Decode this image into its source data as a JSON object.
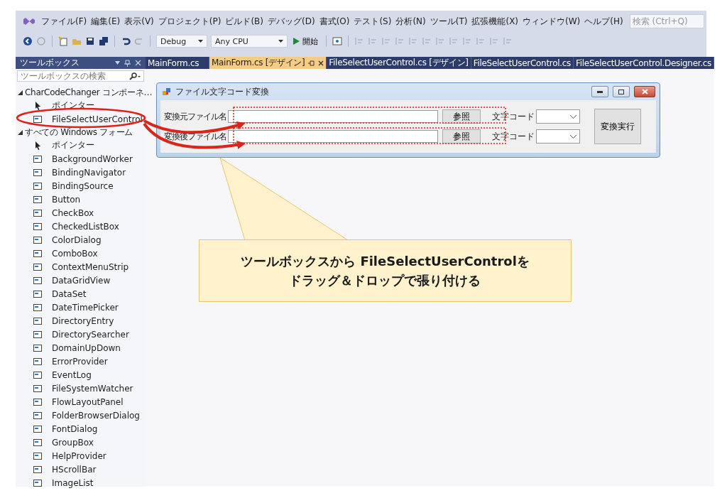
{
  "menu_bar": {
    "items": [
      "ファイル(F)",
      "編集(E)",
      "表示(V)",
      "プロジェクト(P)",
      "ビルド(B)",
      "デバッグ(D)",
      "書式(O)",
      "テスト(S)",
      "分析(N)",
      "ツール(T)",
      "拡張機能(X)",
      "ウィンドウ(W)",
      "ヘルプ(H)"
    ],
    "search": {
      "placeholder": "検索 (Ctrl+Q)"
    }
  },
  "toolbar": {
    "configuration": "Debug",
    "platform": "Any CPU",
    "start_button": "開始"
  },
  "toolbox": {
    "title": "ツールボックス",
    "search": {
      "placeholder": "ツールボックスの検索"
    },
    "groups": [
      {
        "label": "CharCodeChanger コンポーネ…",
        "expanded": true,
        "children": [
          {
            "label": "ポインター",
            "kind": "pointer"
          },
          {
            "label": "FileSelectUserControl",
            "kind": "control"
          }
        ]
      },
      {
        "label": "すべての Windows フォーム",
        "expanded": true,
        "children": [
          {
            "label": "ポインター",
            "kind": "pointer"
          },
          {
            "label": "BackgroundWorker",
            "kind": "control"
          },
          {
            "label": "BindingNavigator",
            "kind": "control"
          },
          {
            "label": "BindingSource",
            "kind": "control"
          },
          {
            "label": "Button",
            "kind": "control"
          },
          {
            "label": "CheckBox",
            "kind": "control"
          },
          {
            "label": "CheckedListBox",
            "kind": "control"
          },
          {
            "label": "ColorDialog",
            "kind": "control"
          },
          {
            "label": "ComboBox",
            "kind": "control"
          },
          {
            "label": "ContextMenuStrip",
            "kind": "control"
          },
          {
            "label": "DataGridView",
            "kind": "control"
          },
          {
            "label": "DataSet",
            "kind": "control"
          },
          {
            "label": "DateTimePicker",
            "kind": "control"
          },
          {
            "label": "DirectoryEntry",
            "kind": "control"
          },
          {
            "label": "DirectorySearcher",
            "kind": "control"
          },
          {
            "label": "DomainUpDown",
            "kind": "control"
          },
          {
            "label": "ErrorProvider",
            "kind": "control"
          },
          {
            "label": "EventLog",
            "kind": "control"
          },
          {
            "label": "FileSystemWatcher",
            "kind": "control"
          },
          {
            "label": "FlowLayoutPanel",
            "kind": "control"
          },
          {
            "label": "FolderBrowserDialog",
            "kind": "control"
          },
          {
            "label": "FontDialog",
            "kind": "control"
          },
          {
            "label": "GroupBox",
            "kind": "control"
          },
          {
            "label": "HelpProvider",
            "kind": "control"
          },
          {
            "label": "HScrollBar",
            "kind": "control"
          },
          {
            "label": "ImageList",
            "kind": "control"
          }
        ]
      }
    ]
  },
  "tabs": [
    {
      "label": "MainForm.cs",
      "selected": false
    },
    {
      "label": "MainForm.cs [デザイン]",
      "selected": true
    },
    {
      "label": "FileSelectUserControl.cs [デザイン]",
      "selected": false
    },
    {
      "label": "FileSelectUserControl.cs",
      "selected": false
    },
    {
      "label": "FileSelectUserControl.Designer.cs",
      "selected": false
    }
  ],
  "form": {
    "title": "ファイル文字コード変換",
    "rows": [
      {
        "label": "変換元ファイル名",
        "browse_button": "参照",
        "encoding_label": "文字コード"
      },
      {
        "label": "変換後ファイル名",
        "browse_button": "参照",
        "encoding_label": "文字コード"
      }
    ],
    "run_button": "変換実行"
  },
  "callout": {
    "lines": [
      "ツールボックスから FileSelectUserControlを",
      "ドラッグ＆ドロップで張り付ける"
    ]
  }
}
